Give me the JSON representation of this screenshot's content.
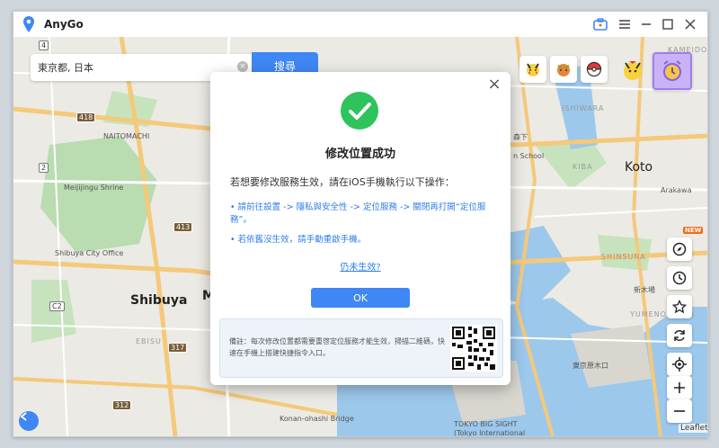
{
  "app": {
    "title": "AnyGo"
  },
  "titlebar": {
    "icons": [
      "toolbox-icon",
      "menu-icon",
      "minimize-icon",
      "maximize-icon",
      "close-icon"
    ]
  },
  "search": {
    "value": "東京都, 日本",
    "placeholder": "",
    "button_label": "搜尋"
  },
  "map_labels": {
    "naitomachi": "NAITOMACHI",
    "meiji": "Meijijingu Shrine",
    "shibuya_office": "Shibuya City Office",
    "shibuya": "Shibuya",
    "ebisu": "EBISU",
    "konan_bridge": "Konan-ohashi Bridge",
    "koto": "Koto",
    "kameido": "KAMEIDO",
    "ishiwara": "ISHIWARA",
    "morishita": "森下",
    "kiba": "KIBA",
    "arakawa": "Arakawa",
    "shinsuna": "SHINSUNA",
    "yumenoshima": "YUMENOSHIMA",
    "tokyo_big_sight": "TOKYO BIG SIGHT",
    "big_sight_jp": "(Tokyo International",
    "big_sight_jp2": "Exhibition Center)",
    "school": "n School",
    "mark_m": "M",
    "tokyo_port": "東京原木口",
    "shin_kiba": "新木場",
    "r413": "413",
    "r418": "418",
    "r317": "317",
    "r312": "312",
    "r2": "2",
    "rc2": "C2",
    "r4": "4"
  },
  "dialog": {
    "title": "修改位置成功",
    "subtitle": "若想要修改服務生效，請在iOS手機執行以下操作：",
    "step1": "• 請前往設置 -> 隱私與安全性 -> 定位服務 -> 關閉再打開“定位服務”。",
    "step2": "• 若依舊沒生效，請手動重啟手機。",
    "link": "仍未生效?",
    "ok_label": "OK",
    "note": "備註：每次修改位置都需要重啓定位服務才能生效，掃描二維碼，快速在手機上搭建快捷指令入口。"
  },
  "side_tools": {
    "new_badge": "NEW"
  },
  "attribution": "Leaflet",
  "colors": {
    "accent": "#3f87f5",
    "success": "#2ec35b",
    "link": "#2f7ee8"
  }
}
